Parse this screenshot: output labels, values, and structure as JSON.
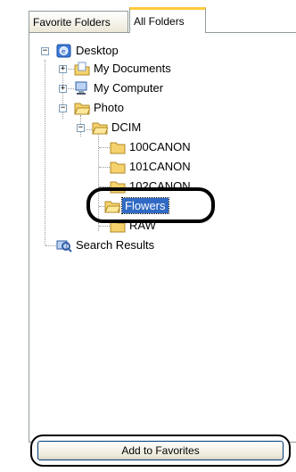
{
  "tabs": [
    {
      "label": "Favorite Folders",
      "active": false
    },
    {
      "label": "All Folders",
      "active": true
    }
  ],
  "tree": {
    "root": "Desktop",
    "items": [
      {
        "label": "My Documents"
      },
      {
        "label": "My Computer"
      },
      {
        "label": "Photo"
      },
      {
        "label": "DCIM"
      },
      {
        "label": "100CANON"
      },
      {
        "label": "101CANON"
      },
      {
        "label": "102CANON"
      },
      {
        "label": "Flowers",
        "selected": true
      },
      {
        "label": "RAW"
      },
      {
        "label": "Search Results"
      }
    ]
  },
  "buttons": {
    "add_to_favorites": "Add to Favorites"
  },
  "colors": {
    "selection": "#316ac5",
    "tab_highlight": "#ffc83c",
    "folder": "#f5d26b"
  }
}
